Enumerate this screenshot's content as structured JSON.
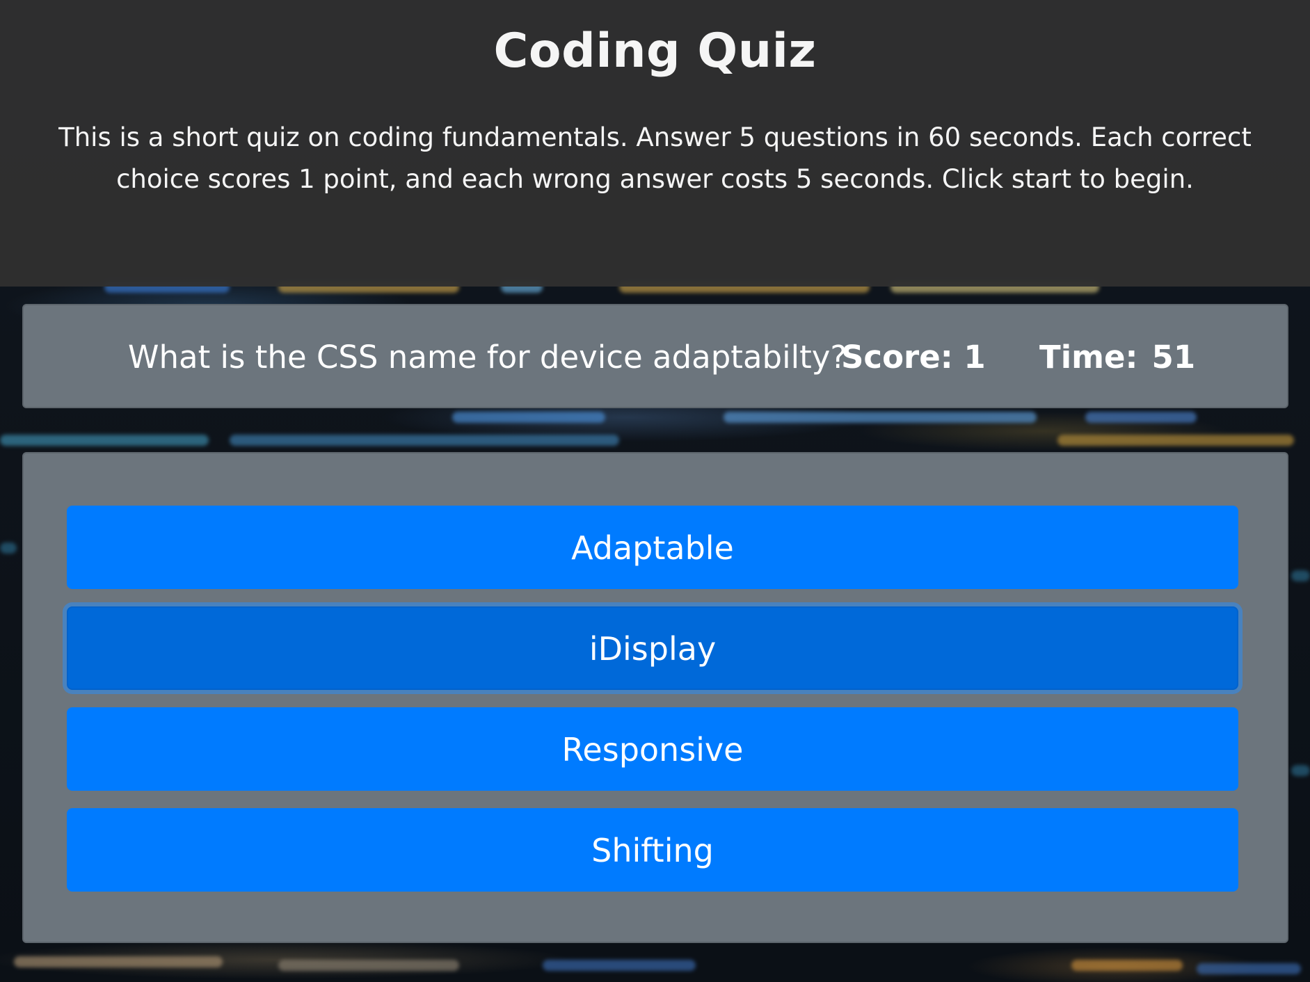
{
  "header": {
    "title": "Coding Quiz",
    "description": "This is a short quiz on coding fundamentals. Answer 5 questions in 60 seconds. Each correct choice scores 1 point, and each wrong answer costs 5 seconds. Click start to begin."
  },
  "status": {
    "question": "What is the CSS name for device adaptabilty?",
    "score_label": "Score: 1",
    "time_label": "Time:",
    "time_value": "51"
  },
  "answers": [
    {
      "label": "Adaptable"
    },
    {
      "label": "iDisplay"
    },
    {
      "label": "Responsive"
    },
    {
      "label": "Shifting"
    }
  ],
  "colors": {
    "header_bg": "#303030",
    "card_bg": "#6c757d",
    "button_primary": "#007bff",
    "button_focused": "#0069d9"
  }
}
